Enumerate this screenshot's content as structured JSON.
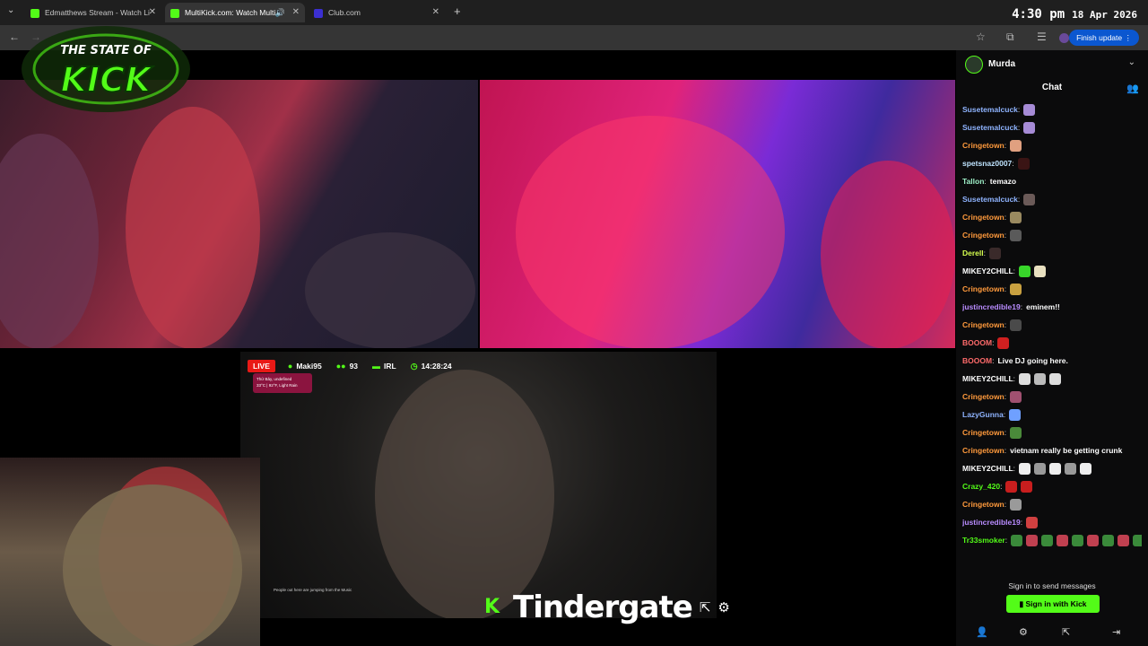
{
  "browser": {
    "tabs": [
      {
        "label": "Edmatthews Stream - Watch Li",
        "favicon_color": "#53fc18",
        "active": false
      },
      {
        "label": "MultiKick.com: Watch Multi",
        "favicon_color": "#53fc18",
        "active": true
      },
      {
        "label": "Club.com",
        "favicon_color": "#3b2fd1",
        "active": false
      }
    ],
    "time": "4:30 pm",
    "date": "18 Apr 2026",
    "update_button": "Finish update"
  },
  "overlay": {
    "logo_line1": "THE STATE OF",
    "logo_line2": "KICK",
    "live_badge": "LIVE",
    "streamer": "Maki95",
    "viewers": "93",
    "category": "IRL",
    "uptime": "14:28:24",
    "weather_line1": "Thứ Bảy, undefined",
    "weather_line2": "33°C | 92°F, Light Rain",
    "subtitle": "People out here are jumping from the Music",
    "channel_name": "Tindergate"
  },
  "chat": {
    "channel": "Murda",
    "title": "Chat",
    "messages": [
      {
        "user": "Susetemalcuck",
        "color": "#8fb4ff",
        "text": "",
        "emotes": [
          "#a68bd6"
        ]
      },
      {
        "user": "Susetemalcuck",
        "color": "#8fb4ff",
        "text": "",
        "emotes": [
          "#a68bd6"
        ]
      },
      {
        "user": "Cringetown",
        "color": "#ff9a3c",
        "text": "",
        "emotes": [
          "#e0a080"
        ]
      },
      {
        "user": "spetsnaz0007",
        "color": "#bfe4ff",
        "text": "",
        "emotes": [
          "#3a1414"
        ]
      },
      {
        "user": "Tallon",
        "color": "#9ef0c8",
        "text": "temazo",
        "emotes": []
      },
      {
        "user": "Susetemalcuck",
        "color": "#8fb4ff",
        "text": "",
        "emotes": [
          "#6b5a58"
        ]
      },
      {
        "user": "Cringetown",
        "color": "#ff9a3c",
        "text": "",
        "emotes": [
          "#9a8a60"
        ]
      },
      {
        "user": "Cringetown",
        "color": "#ff9a3c",
        "text": "",
        "emotes": [
          "#5a5a5a"
        ]
      },
      {
        "user": "Derell",
        "color": "#d6ff4f",
        "text": "",
        "emotes": [
          "#3a2a2a"
        ]
      },
      {
        "user": "MIKEY2CHILL",
        "color": "#ffffff",
        "text": "",
        "emotes": [
          "#38d62a",
          "#e8e0c0"
        ]
      },
      {
        "user": "Cringetown",
        "color": "#ff9a3c",
        "text": "",
        "emotes": [
          "#c8a040"
        ]
      },
      {
        "user": "justincredible19",
        "color": "#b98cff",
        "text": "eminem!!",
        "emotes": []
      },
      {
        "user": "Cringetown",
        "color": "#ff9a3c",
        "text": "",
        "emotes": [
          "#4a4a4a"
        ]
      },
      {
        "user": "BOOOM",
        "color": "#ff6b6b",
        "text": "",
        "emotes": [
          "#d02020"
        ]
      },
      {
        "user": "BOOOM",
        "color": "#ff6b6b",
        "text": "Live DJ going here.",
        "emotes": []
      },
      {
        "user": "MIKEY2CHILL",
        "color": "#ffffff",
        "text": "",
        "emotes": [
          "#dddddd",
          "#bbbbbb",
          "#dddddd"
        ]
      },
      {
        "user": "Cringetown",
        "color": "#ff9a3c",
        "text": "",
        "emotes": [
          "#a05070"
        ]
      },
      {
        "user": "LazyGunna",
        "color": "#8fb4ff",
        "text": "",
        "emotes": [
          "#6fa0ff"
        ]
      },
      {
        "user": "Cringetown",
        "color": "#ff9a3c",
        "text": "",
        "emotes": [
          "#4a8a3a"
        ]
      },
      {
        "user": "Cringetown",
        "color": "#ff9a3c",
        "text": "vietnam really be getting crunk",
        "emotes": []
      },
      {
        "user": "MIKEY2CHILL",
        "color": "#ffffff",
        "text": "",
        "emotes": [
          "#eeeeee",
          "#999999",
          "#eeeeee",
          "#999999",
          "#eeeeee"
        ]
      },
      {
        "user": "Crazy_420",
        "color": "#53fc18",
        "text": "",
        "emotes": [
          "#c81e1e",
          "#c81e1e"
        ]
      },
      {
        "user": "Cringetown",
        "color": "#ff9a3c",
        "text": "",
        "emotes": [
          "#9a9a9a"
        ]
      },
      {
        "user": "justincredible19",
        "color": "#b98cff",
        "text": "",
        "emotes": [
          "#d04040"
        ]
      },
      {
        "user": "Tr33smoker",
        "color": "#53fc18",
        "text": "",
        "emotes": [
          "#3a8a3a",
          "#c04050",
          "#3a8a3a",
          "#c04050",
          "#3a8a3a",
          "#c04050",
          "#3a8a3a",
          "#c04050",
          "#3a8a3a"
        ]
      }
    ],
    "sign_in_prompt": "Sign in to send messages",
    "sign_in_button": "Sign in with Kick"
  }
}
